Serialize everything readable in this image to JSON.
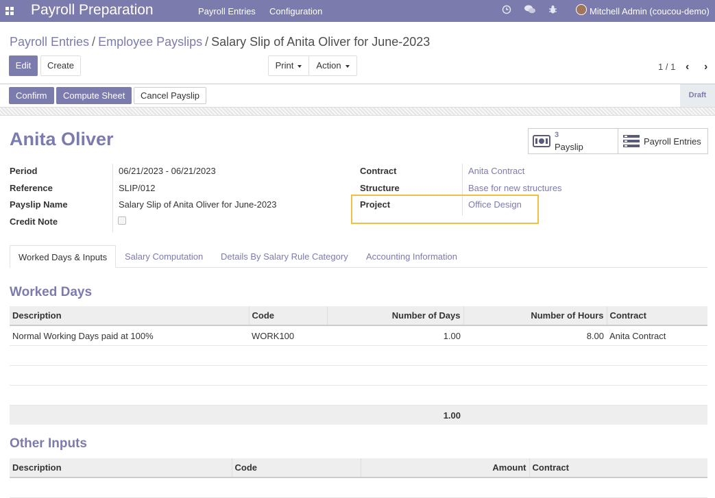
{
  "navbar": {
    "app_title": "Payroll Preparation",
    "menu": [
      "Payroll Entries",
      "Configuration"
    ],
    "icons": [
      "clock-icon",
      "chat-icon",
      "bug-icon"
    ],
    "user": "Mitchell Admin (coucou-demo)"
  },
  "breadcrumb": [
    "Payroll Entries",
    "Employee Payslips",
    "Salary Slip of Anita Oliver for June-2023"
  ],
  "buttons": {
    "edit": "Edit",
    "create": "Create",
    "print": "Print",
    "action": "Action"
  },
  "pager": "1 / 1",
  "statusbar": {
    "confirm": "Confirm",
    "compute": "Compute Sheet",
    "cancel": "Cancel Payslip",
    "state": "Draft"
  },
  "employee_name": "Anita Oliver",
  "smart_buttons": {
    "payslip_count": "3",
    "payslip_label": "Payslip",
    "entries_label": "Payroll Entries"
  },
  "fields": {
    "period_label": "Period",
    "period": "06/21/2023 - 06/21/2023",
    "reference_label": "Reference",
    "reference": "SLIP/012",
    "payslip_name_label": "Payslip Name",
    "payslip_name": "Salary Slip of Anita Oliver for June-2023",
    "credit_note_label": "Credit Note",
    "contract_label": "Contract",
    "contract": "Anita Contract",
    "structure_label": "Structure",
    "structure": "Base for new structures",
    "project_label": "Project",
    "project": "Office Design"
  },
  "tabs": [
    "Worked Days & Inputs",
    "Salary Computation",
    "Details By Salary Rule Category",
    "Accounting Information"
  ],
  "worked_days": {
    "title": "Worked Days",
    "headers": [
      "Description",
      "Code",
      "Number of Days",
      "Number of Hours",
      "Contract"
    ],
    "rows": [
      [
        "Normal Working Days paid at 100%",
        "WORK100",
        "1.00",
        "8.00",
        "Anita Contract"
      ]
    ],
    "total_days": "1.00"
  },
  "other_inputs": {
    "title": "Other Inputs",
    "headers": [
      "Description",
      "Code",
      "Amount",
      "Contract"
    ]
  }
}
